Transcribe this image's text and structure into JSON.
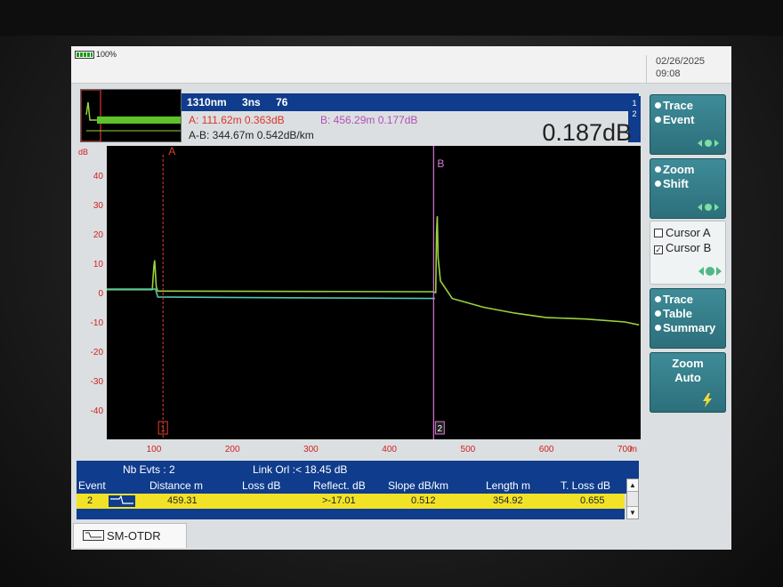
{
  "status": {
    "battery_pct": "100%",
    "date": "02/26/2025",
    "time": "09:08"
  },
  "header": {
    "wavelength": "1310nm",
    "pulse": "3ns",
    "value": "76",
    "marker_a": "A: 111.62m  0.363dB",
    "marker_b": "B: 456.29m  0.177dB",
    "a_minus_b": "A-B: 344.67m  0.542dB/km",
    "big_loss": "0.187dB",
    "trace_index": [
      "1",
      "2"
    ]
  },
  "chart_data": {
    "type": "line",
    "ylabel": "dB",
    "xlabel": "m",
    "xlim": [
      40,
      720
    ],
    "ylim": [
      -50,
      50
    ],
    "x_ticks": [
      100,
      200,
      300,
      400,
      500,
      600,
      700
    ],
    "y_ticks": [
      40,
      30,
      20,
      10,
      0,
      -10,
      -20,
      -30,
      -40
    ],
    "cursor_a": {
      "label": "A",
      "x": 111.62,
      "event_label": "1"
    },
    "cursor_b": {
      "label": "B",
      "x": 456.29,
      "event_label": "2"
    },
    "series": [
      {
        "color": "#9bd23a",
        "x": [
          40,
          98,
          100,
          101,
          103,
          105,
          120,
          300,
          455,
          459,
          460,
          461,
          462,
          465,
          480,
          520,
          560,
          600,
          650,
          700,
          718
        ],
        "y": [
          1,
          1,
          9,
          11,
          2,
          0.5,
          0.5,
          0.4,
          0.3,
          0,
          20,
          26,
          12,
          4,
          -2,
          -5,
          -7,
          -8.5,
          -9,
          -10,
          -11
        ]
      },
      {
        "color": "#4fc7b0",
        "x": [
          40,
          102,
          105,
          300,
          455,
          458
        ],
        "y": [
          1.2,
          1.2,
          -1.5,
          -1.8,
          -2.0,
          -2.0
        ]
      }
    ]
  },
  "side": {
    "trace_event": [
      "Trace",
      "Event"
    ],
    "zoom_shift": [
      "Zoom",
      "Shift"
    ],
    "cursor_a": "Cursor A",
    "cursor_b": "Cursor B",
    "trace_table_summary": [
      "Trace",
      "Table",
      "Summary"
    ],
    "zoom": "Zoom",
    "auto": "Auto"
  },
  "events": {
    "nb_evts": "Nb Evts : 2",
    "link_orl": "Link Orl :< 18.45 dB",
    "columns": [
      "Event",
      "Distance  m",
      "Loss dB",
      "Reflect. dB",
      "Slope  dB/km",
      "Length m",
      "T. Loss dB"
    ],
    "rows": [
      {
        "event": "2",
        "distance": "459.31",
        "loss": "",
        "reflect": ">-17.01",
        "slope": "0.512",
        "length": "354.92",
        "tloss": "0.655"
      }
    ]
  },
  "tab": {
    "label": "SM-OTDR"
  }
}
